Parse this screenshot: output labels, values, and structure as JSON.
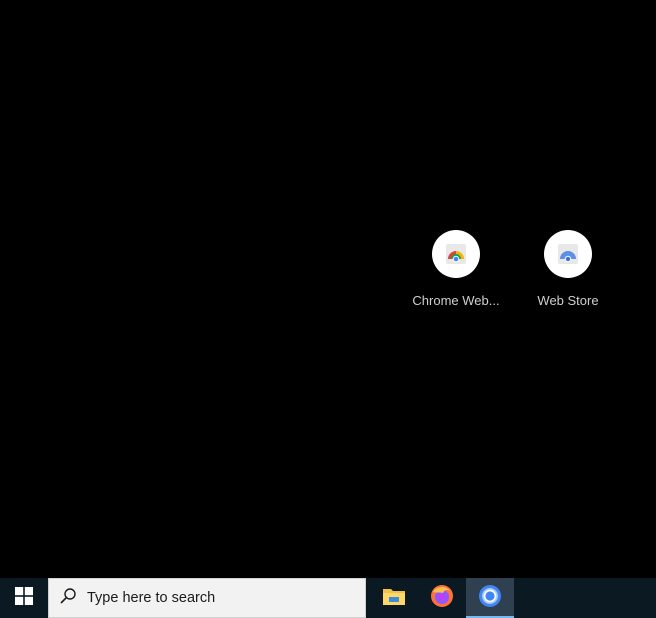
{
  "desktop": {
    "background": "#000000",
    "shortcuts": [
      {
        "label": "Chrome Web...",
        "icon": "chrome-web-store-icon"
      },
      {
        "label": "Web Store",
        "icon": "web-store-icon"
      }
    ]
  },
  "taskbar": {
    "start_icon": "windows-logo-icon",
    "search": {
      "placeholder": "Type here to search",
      "icon": "search-icon"
    },
    "apps": [
      {
        "name": "File Explorer",
        "icon": "file-explorer-icon",
        "active": false
      },
      {
        "name": "Firefox",
        "icon": "firefox-icon",
        "active": false
      },
      {
        "name": "Google Chrome",
        "icon": "chrome-icon",
        "active": true
      }
    ],
    "accent": "#76b9ed"
  }
}
